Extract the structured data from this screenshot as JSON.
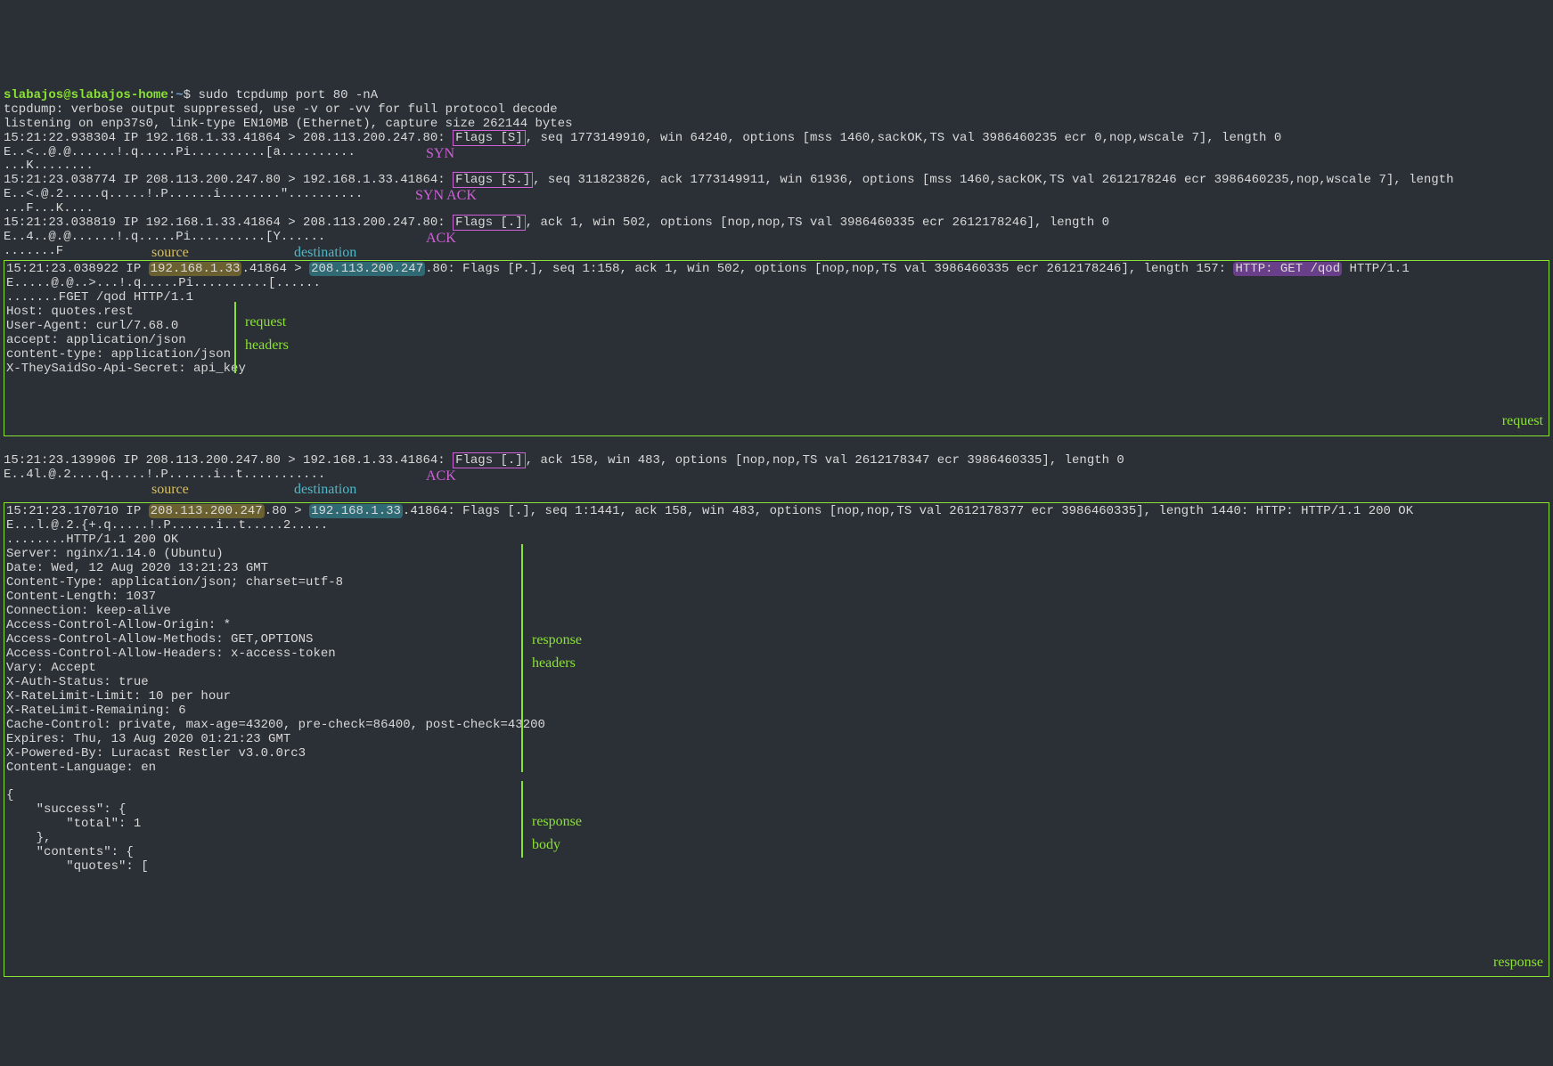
{
  "prompt": {
    "user": "slabajos@slabajos-home",
    "path": "~",
    "sep": ":",
    "dollar": "$ ",
    "cmd": "sudo tcpdump port 80 -nA"
  },
  "line1": "tcpdump: verbose output suppressed, use -v or -vv for full protocol decode",
  "line2": "listening on enp37s0, link-type EN10MB (Ethernet), capture size 262144 bytes",
  "pkt1": {
    "pre": "15:21:22.938304 IP 192.168.1.33.41864 > 208.113.200.247.80: ",
    "flags": "Flags [S]",
    "post": ", seq 1773149910, win 64240, options [mss 1460,sackOK,TS val 3986460235 ecr 0,nop,wscale 7], length 0",
    "hex": "E..<..@.@......!.q.....Pi..........[a..........",
    "hex2": "...K........",
    "annot": "SYN"
  },
  "pkt2": {
    "pre": "15:21:23.038774 IP 208.113.200.247.80 > 192.168.1.33.41864: ",
    "flags": "Flags [S.]",
    "post": ", seq 311823826, ack 1773149911, win 61936, options [mss 1460,sackOK,TS val 2612178246 ecr 3986460235,nop,wscale 7], length",
    "hex": "E..<.@.2.....q.....!.P......i........\"..........",
    "hex2": "...F...K....",
    "annot": "SYN ACK"
  },
  "pkt3": {
    "pre": "15:21:23.038819 IP 192.168.1.33.41864 > 208.113.200.247.80: ",
    "flags": "Flags [.]",
    "post": ", ack 1, win 502, options [nop,nop,TS val 3986460335 ecr 2612178246], length 0",
    "hex": "E..4..@.@......!.q.....Pi..........[Y......",
    "hex2": ".......F",
    "annot": "ACK"
  },
  "srcdst1": {
    "src": "source",
    "dst": "destination"
  },
  "req": {
    "pre": "15:21:23.038922 IP ",
    "src": "192.168.1.33",
    "mid1": ".41864 > ",
    "dst": "208.113.200.247",
    "mid2": ".80: Flags [P.], seq 1:158, ack 1, win 502, options [nop,nop,TS val 3986460335 ecr 2612178246], length 157: ",
    "http_hl": "HTTP: GET /qod",
    "post": " HTTP/1.1",
    "hex": "E.....@.@..>...!.q.....Pi..........[......",
    "hex2": ".......FGET /qod HTTP/1.1",
    "h1": "Host: quotes.rest",
    "h2": "User-Agent: curl/7.68.0",
    "h3": "accept: application/json",
    "h4": "content-type: application/json",
    "h5": "X-TheySaidSo-Api-Secret: api_key",
    "lbl_headers_a": "request",
    "lbl_headers_b": "headers",
    "lbl_box": "request"
  },
  "pkt4": {
    "pre": "15:21:23.139906 IP 208.113.200.247.80 > 192.168.1.33.41864: ",
    "flags": "Flags [.]",
    "post": ", ack 158, win 483, options [nop,nop,TS val 2612178347 ecr 3986460335], length 0",
    "hex": "E..4l.@.2....q.....!.P......i..t...........",
    "annot": "ACK"
  },
  "srcdst2": {
    "src": "source",
    "dst": "destination"
  },
  "resp": {
    "pre": "15:21:23.170710 IP ",
    "src": "208.113.200.247",
    "mid1": ".80 > ",
    "dst": "192.168.1.33",
    "mid2": ".41864: Flags [.], seq 1:1441, ack 158, win 483, options [nop,nop,TS val 2612178377 ecr 3986460335], length 1440: HTTP: HTTP/1.1 200 OK",
    "hex": "E...l.@.2.{+.q.....!.P......i..t.....2.....",
    "hex2": "........HTTP/1.1 200 OK",
    "h": [
      "Server: nginx/1.14.0 (Ubuntu)",
      "Date: Wed, 12 Aug 2020 13:21:23 GMT",
      "Content-Type: application/json; charset=utf-8",
      "Content-Length: 1037",
      "Connection: keep-alive",
      "Access-Control-Allow-Origin: *",
      "Access-Control-Allow-Methods: GET,OPTIONS",
      "Access-Control-Allow-Headers: x-access-token",
      "Vary: Accept",
      "X-Auth-Status: true",
      "X-RateLimit-Limit: 10 per hour",
      "X-RateLimit-Remaining: 6",
      "Cache-Control: private, max-age=43200, pre-check=86400, post-check=43200",
      "Expires: Thu, 13 Aug 2020 01:21:23 GMT",
      "X-Powered-By: Luracast Restler v3.0.0rc3",
      "Content-Language: en"
    ],
    "body": [
      "{",
      "    \"success\": {",
      "        \"total\": 1",
      "    },",
      "    \"contents\": {",
      "        \"quotes\": ["
    ],
    "lbl_hdr_a": "response",
    "lbl_hdr_b": "headers",
    "lbl_body_a": "response",
    "lbl_body_b": "body",
    "lbl_box": "response"
  }
}
